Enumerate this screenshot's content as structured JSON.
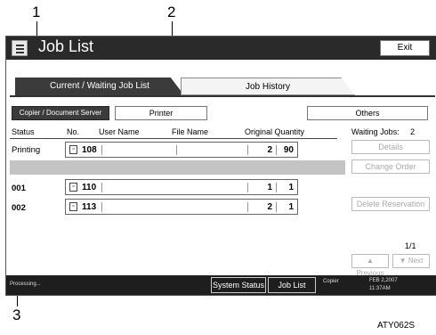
{
  "callouts": [
    "1",
    "2",
    "3"
  ],
  "window": {
    "title": "Job List",
    "exit_label": "Exit"
  },
  "tabs": [
    {
      "label": "Current / Waiting Job List",
      "selected": true
    },
    {
      "label": "Job History",
      "selected": false
    }
  ],
  "filters": {
    "copier": "Copier / Document Server",
    "printer": "Printer",
    "others": "Others"
  },
  "columns": {
    "status": "Status",
    "no": "No.",
    "user": "User Name",
    "file": "File Name",
    "orig_qty": "Original Quantity"
  },
  "rows": [
    {
      "status": "Printing",
      "no": "108",
      "original": "2",
      "quantity": "90"
    },
    {
      "status": "001",
      "no": "110",
      "original": "1",
      "quantity": "1"
    },
    {
      "status": "002",
      "no": "113",
      "original": "2",
      "quantity": "1"
    }
  ],
  "side": {
    "waiting_label": "Waiting Jobs:",
    "waiting_count": "2",
    "details": "Details",
    "change_order": "Change Order",
    "delete_reservation": "Delete Reservation",
    "page": "1/1",
    "previous": "▲ Previous",
    "next": "▼ Next"
  },
  "statusbar": {
    "message": "Processing...",
    "system_status": "System Status",
    "job_list": "Job List",
    "mode": "Copier",
    "date": "FEB  2,2007",
    "time": "11:37AM"
  },
  "figure_code": "ATY062S"
}
